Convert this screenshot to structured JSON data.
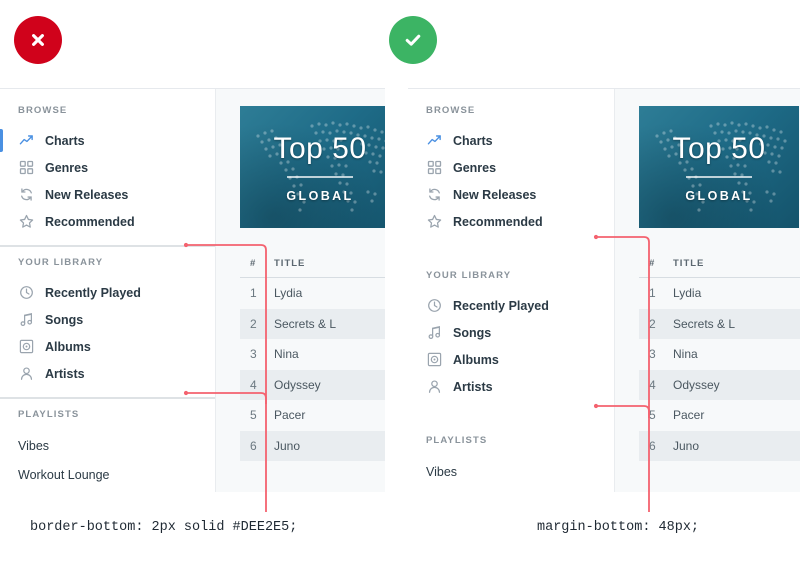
{
  "badges": {
    "bad": {
      "icon": "x-circle-icon",
      "color": "#D0021B",
      "meaning": "incorrect"
    },
    "good": {
      "icon": "check-circle-icon",
      "color": "#3CB464",
      "meaning": "correct"
    }
  },
  "annotations": {
    "bad_label": "border-bottom: 2px solid #DEE2E5;",
    "good_label": "margin-bottom: 48px;",
    "line_color": "#F4626F"
  },
  "sidebar": {
    "groups": [
      {
        "heading": "BROWSE",
        "items": [
          {
            "label": "Charts",
            "icon": "trending-up-icon",
            "active": true
          },
          {
            "label": "Genres",
            "icon": "grid-icon",
            "active": false
          },
          {
            "label": "New Releases",
            "icon": "refresh-icon",
            "active": false
          },
          {
            "label": "Recommended",
            "icon": "star-icon",
            "active": false
          }
        ]
      },
      {
        "heading": "YOUR LIBRARY",
        "items": [
          {
            "label": "Recently Played",
            "icon": "clock-icon",
            "active": false
          },
          {
            "label": "Songs",
            "icon": "music-note-icon",
            "active": false
          },
          {
            "label": "Albums",
            "icon": "album-disc-icon",
            "active": false
          },
          {
            "label": "Artists",
            "icon": "person-icon",
            "active": false
          }
        ]
      },
      {
        "heading": "PLAYLISTS",
        "items": [
          {
            "label": "Vibes",
            "icon": "",
            "active": false
          },
          {
            "label": "Workout Lounge",
            "icon": "",
            "active": false
          }
        ]
      }
    ]
  },
  "cover": {
    "title": "Top 50",
    "subtitle": "GLOBAL",
    "accent": "#1E6B87"
  },
  "tracklist": {
    "columns": {
      "number": "#",
      "title": "TITLE"
    },
    "rows": [
      {
        "number": "1",
        "title": "Lydia"
      },
      {
        "number": "2",
        "title": "Secrets & L"
      },
      {
        "number": "3",
        "title": "Nina"
      },
      {
        "number": "4",
        "title": "Odyssey"
      },
      {
        "number": "5",
        "title": "Pacer"
      },
      {
        "number": "6",
        "title": "Juno"
      }
    ]
  },
  "theme": {
    "active_blue": "#4A90E2",
    "divider": "#DEE2E5",
    "content_bg": "#F7F9FA",
    "row_alt_bg": "#E9EDF0",
    "text": "#2B3A45",
    "muted": "#8A939B"
  }
}
